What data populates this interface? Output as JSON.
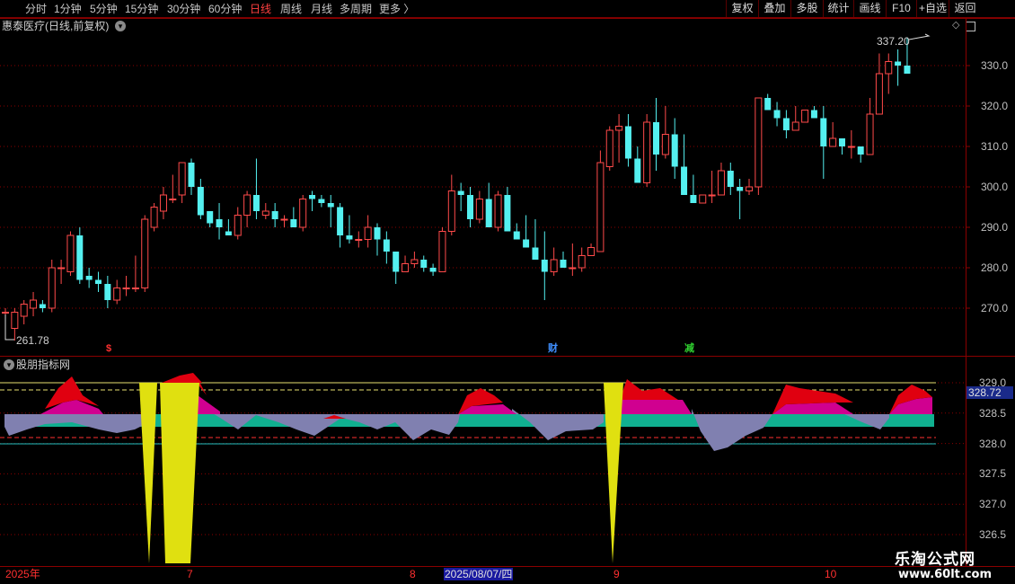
{
  "toolbar": {
    "timeframes": [
      "分时",
      "1分钟",
      "5分钟",
      "15分钟",
      "30分钟",
      "60分钟",
      "日线",
      "周线",
      "月线",
      "多周期",
      "更多"
    ],
    "active": "日线",
    "buttons": [
      "复权",
      "叠加",
      "多股",
      "统计",
      "画线",
      "F10",
      "+自选",
      "返回"
    ],
    "more_arrow": "〉"
  },
  "main": {
    "stock_title": "惠泰医疗(日线,前复权)",
    "high_label": "337.20",
    "low_label": "261.78",
    "y_ticks": [
      "330.0",
      "320.0",
      "310.0",
      "300.0",
      "290.0",
      "280.0",
      "270.0"
    ],
    "markers": [
      {
        "text": "$",
        "color": "#ff3030"
      },
      {
        "text": "财",
        "color": "#4090ff"
      },
      {
        "text": "减",
        "color": "#30d030"
      }
    ]
  },
  "indicator": {
    "title": "股朋指标网",
    "current_value": "328.72",
    "y_ticks": [
      "329.0",
      "328.5",
      "328.0",
      "327.5",
      "327.0",
      "326.5"
    ]
  },
  "x_axis": {
    "labels": [
      "2025年",
      "7",
      "8",
      "2025/08/07/四",
      "9",
      "10"
    ],
    "selected": "2025/08/07/四"
  },
  "watermark": {
    "line1": "乐淘公式网",
    "line2": "www.60lt.com"
  },
  "colors": {
    "up": "#ff4a4a",
    "down": "#54f0f0",
    "grid": "#8a0000",
    "indicator_red": "#e00010",
    "indicator_magenta": "#d00090",
    "indicator_green": "#10b090",
    "indicator_purple": "#8080b0",
    "indicator_yellow": "#e0e010"
  },
  "chart_data": {
    "type": "candlestick",
    "price_axis": {
      "min": 261.78,
      "max": 337.2
    },
    "candles": [
      [
        269,
        269,
        268,
        270
      ],
      [
        265,
        269,
        262,
        270
      ],
      [
        268,
        271,
        266,
        272
      ],
      [
        270,
        272,
        268,
        274
      ],
      [
        271,
        270,
        269,
        272
      ],
      [
        270,
        280,
        269,
        282
      ],
      [
        280,
        280,
        276,
        282
      ],
      [
        279,
        288,
        278,
        289
      ],
      [
        288,
        277,
        276,
        290
      ],
      [
        278,
        277,
        275,
        280
      ],
      [
        277,
        276,
        274,
        279
      ],
      [
        276,
        272,
        270,
        278
      ],
      [
        272,
        275,
        271,
        277
      ],
      [
        275,
        275,
        273,
        278
      ],
      [
        275,
        275,
        274,
        283
      ],
      [
        275,
        292,
        274,
        293
      ],
      [
        290,
        295,
        289,
        296
      ],
      [
        294,
        298,
        292,
        300
      ],
      [
        297,
        297,
        296,
        303
      ],
      [
        298,
        306,
        296,
        306
      ],
      [
        306,
        300,
        298,
        307
      ],
      [
        300,
        293,
        292,
        302
      ],
      [
        294,
        291,
        290,
        294
      ],
      [
        292,
        290,
        287,
        296
      ],
      [
        289,
        288,
        288,
        292
      ],
      [
        288,
        293,
        287,
        295
      ],
      [
        293,
        298,
        290,
        299
      ],
      [
        298,
        294,
        292,
        307
      ],
      [
        293,
        294,
        292,
        296
      ],
      [
        294,
        292,
        290,
        296
      ],
      [
        292,
        292,
        290,
        293
      ],
      [
        292,
        290,
        290,
        295
      ],
      [
        290,
        297,
        289,
        298
      ],
      [
        298,
        297,
        294,
        299
      ],
      [
        297,
        296,
        295,
        298
      ],
      [
        296,
        295,
        290,
        298
      ],
      [
        295,
        288,
        285,
        296
      ],
      [
        288,
        287,
        286,
        293
      ],
      [
        287,
        287,
        285,
        289
      ],
      [
        287,
        290,
        285,
        293
      ],
      [
        290,
        287,
        283,
        291
      ],
      [
        287,
        284,
        281,
        289
      ],
      [
        284,
        279,
        276,
        284
      ],
      [
        279,
        281,
        279,
        283
      ],
      [
        281,
        282,
        280,
        284
      ],
      [
        282,
        280,
        279,
        283
      ],
      [
        280,
        279,
        278,
        281
      ],
      [
        279,
        289,
        280,
        290
      ],
      [
        289,
        299,
        288,
        303
      ],
      [
        299,
        298,
        294,
        301
      ],
      [
        298,
        292,
        290,
        300
      ],
      [
        292,
        297,
        291,
        299
      ],
      [
        297,
        290,
        290,
        301
      ],
      [
        290,
        298,
        289,
        299
      ],
      [
        298,
        289,
        289,
        300
      ],
      [
        289,
        287,
        287,
        291
      ],
      [
        287,
        285,
        285,
        293
      ],
      [
        285,
        282,
        282,
        292
      ],
      [
        282,
        279,
        272,
        289
      ],
      [
        279,
        282,
        278,
        285
      ],
      [
        282,
        280,
        280,
        284
      ],
      [
        280,
        280,
        278,
        286
      ],
      [
        280,
        283,
        279,
        285
      ],
      [
        283,
        285,
        283,
        286
      ],
      [
        284,
        306,
        284,
        309
      ],
      [
        305,
        314,
        304,
        315
      ],
      [
        314,
        315,
        306,
        318
      ],
      [
        315,
        307,
        305,
        318
      ],
      [
        307,
        301,
        301,
        310
      ],
      [
        301,
        316,
        300,
        318
      ],
      [
        316,
        308,
        304,
        322
      ],
      [
        308,
        313,
        307,
        320
      ],
      [
        313,
        305,
        302,
        317
      ],
      [
        305,
        298,
        298,
        313
      ],
      [
        298,
        296,
        296,
        303
      ],
      [
        296,
        298,
        296,
        298
      ],
      [
        298,
        298,
        296,
        304
      ],
      [
        298,
        304,
        298,
        306
      ],
      [
        304,
        300,
        298,
        306
      ],
      [
        300,
        299,
        292,
        302
      ],
      [
        299,
        300,
        298,
        302
      ],
      [
        300,
        322,
        298,
        322
      ],
      [
        322,
        319,
        319,
        323
      ],
      [
        319,
        317,
        315,
        321
      ],
      [
        317,
        314,
        312,
        319
      ],
      [
        314,
        316,
        314,
        320
      ],
      [
        316,
        319,
        316,
        319
      ],
      [
        319,
        317,
        317,
        320
      ],
      [
        317,
        310,
        302,
        320
      ],
      [
        310,
        312,
        310,
        316
      ],
      [
        312,
        310,
        308,
        312
      ],
      [
        310,
        310,
        307,
        314
      ],
      [
        310,
        308,
        306,
        310
      ],
      [
        308,
        318,
        308,
        322
      ],
      [
        318,
        328,
        318,
        333
      ],
      [
        328,
        331,
        323,
        333
      ],
      [
        331,
        330,
        325,
        334
      ],
      [
        330,
        328,
        328,
        337
      ]
    ],
    "indicator_range": {
      "min": 326.5,
      "max": 329.0
    }
  }
}
